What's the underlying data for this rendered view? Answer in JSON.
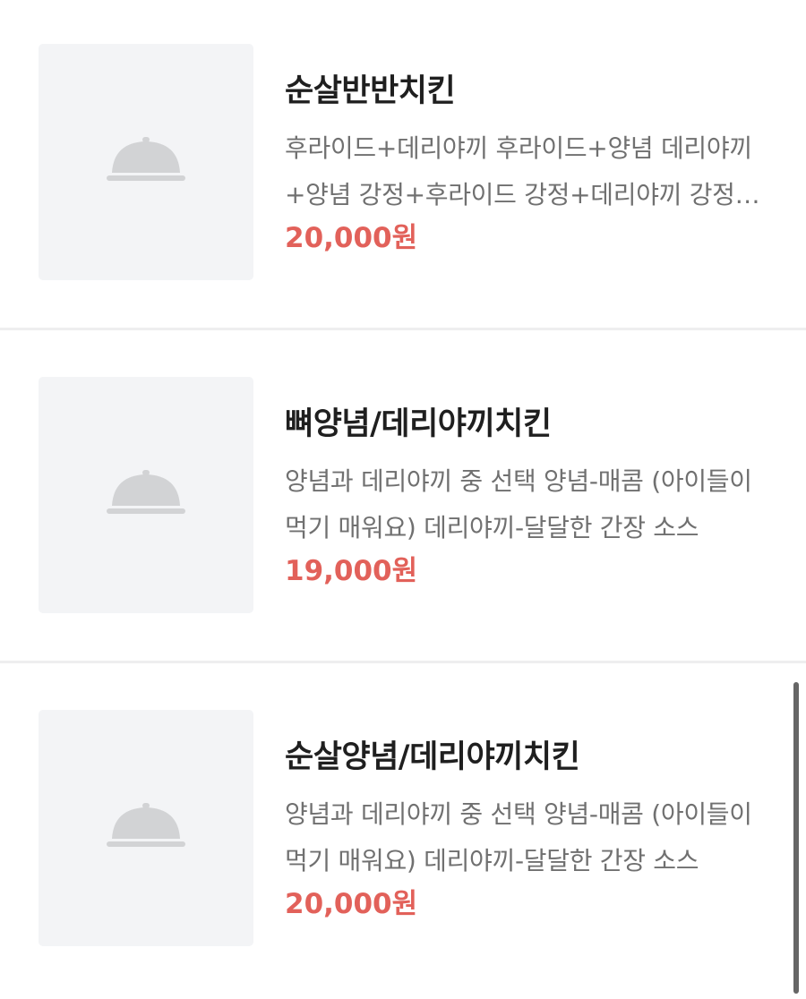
{
  "menu": {
    "items": [
      {
        "name": "순살반반치킨",
        "description": "후라이드+데리야끼 후라이드+양념 데리야끼+양념 강정+후라이드 강정+데리야끼 강정+양념",
        "price": "20,000원",
        "image_icon": "food-cloche-icon"
      },
      {
        "name": "뼈양념/데리야끼치킨",
        "description": "양념과 데리야끼 중 선택 양념-매콤 (아이들이 먹기 매워요) 데리야끼-달달한 간장 소스",
        "price": "19,000원",
        "image_icon": "food-cloche-icon"
      },
      {
        "name": "순살양념/데리야끼치킨",
        "description": "양념과 데리야끼 중 선택 양념-매콤 (아이들이 먹기 매워요) 데리야끼-달달한 간장 소스",
        "price": "20,000원",
        "image_icon": "food-cloche-icon"
      }
    ]
  },
  "colors": {
    "price": "#e2615a",
    "name": "#1f1f1f",
    "description": "#707070",
    "thumbnail_bg": "#f3f4f6",
    "icon": "#d2d3d5"
  }
}
